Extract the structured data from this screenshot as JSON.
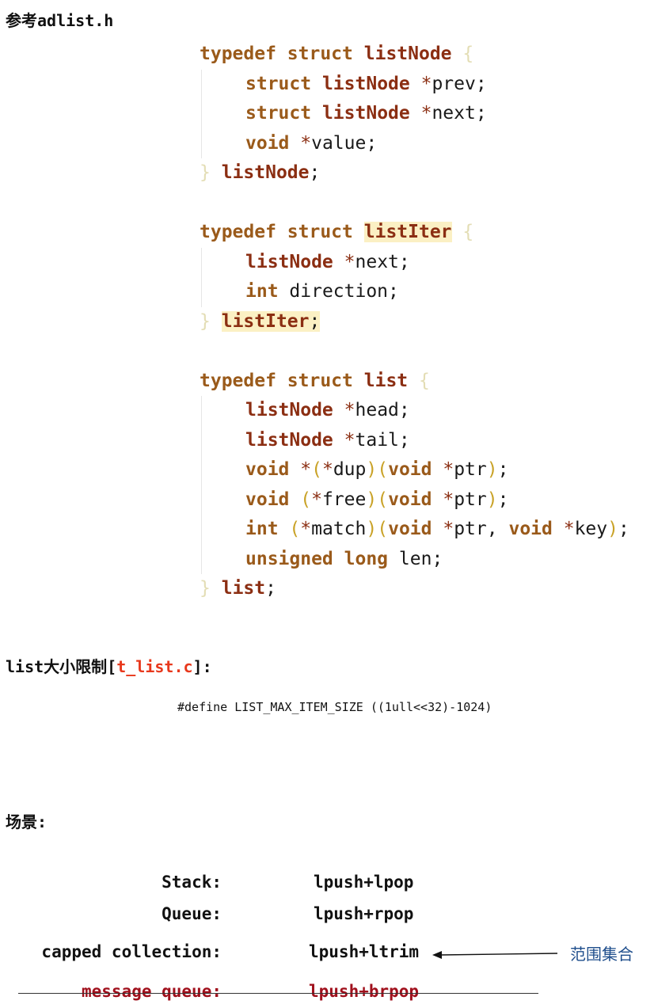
{
  "title_ref": "参考adlist.h",
  "code": {
    "listNode_struct": {
      "l1": [
        "typedef",
        "struct",
        "listNode",
        "{"
      ],
      "l2": [
        "struct",
        "listNode",
        "*",
        "prev",
        ";"
      ],
      "l3": [
        "struct",
        "listNode",
        "*",
        "next",
        ";"
      ],
      "l4": [
        "void",
        "*",
        "value",
        ";"
      ],
      "l5": [
        "}",
        "listNode",
        ";"
      ]
    },
    "listIter_struct": {
      "l1": [
        "typedef",
        "struct",
        "listIter",
        "{"
      ],
      "l2": [
        "listNode",
        "*",
        "next",
        ";"
      ],
      "l3": [
        "int",
        "direction",
        ";"
      ],
      "l4": [
        "}",
        "listIter",
        ";"
      ]
    },
    "list_struct": {
      "l1": [
        "typedef",
        "struct",
        "list",
        "{"
      ],
      "l2": [
        "listNode",
        "*",
        "head",
        ";"
      ],
      "l3": [
        "listNode",
        "*",
        "tail",
        ";"
      ],
      "l4": [
        "void",
        "*",
        "(",
        "*",
        "dup",
        ")",
        "(",
        "void",
        "*",
        "ptr",
        ")",
        ";"
      ],
      "l5": [
        "void",
        "(",
        "*",
        "free",
        ")",
        "(",
        "void",
        "*",
        "ptr",
        ")",
        ";"
      ],
      "l6": [
        "int",
        "(",
        "*",
        "match",
        ")",
        "(",
        "void",
        "*",
        "ptr",
        ",",
        "void",
        "*",
        "key",
        ")",
        ";"
      ],
      "l7": [
        "unsigned",
        "long",
        "len",
        ";"
      ],
      "l8": [
        "}",
        "list",
        ";"
      ]
    }
  },
  "size_limit": {
    "prefix": "list大小限制[",
    "file": "t_list.c",
    "suffix": "]:",
    "define": "#define LIST_MAX_ITEM_SIZE ((1ull<<32)-1024)"
  },
  "scenarios": {
    "heading": "场景:",
    "rows": [
      {
        "label": "Stack:",
        "value": "lpush+lpop"
      },
      {
        "label": "Queue:",
        "value": "lpush+rpop"
      },
      {
        "label": "capped collection:",
        "value": "lpush+ltrim"
      },
      {
        "label": "message queue:",
        "value": "lpush+brpop"
      }
    ],
    "annotation": "范围集合"
  },
  "colors": {
    "keyword": "#9a5a1a",
    "type_name": "#8b2e12",
    "file_link": "#e8381c",
    "strikethrough_text": "#a0101c",
    "annotation": "#1f4e8c",
    "highlight": "#fbf0c4"
  }
}
